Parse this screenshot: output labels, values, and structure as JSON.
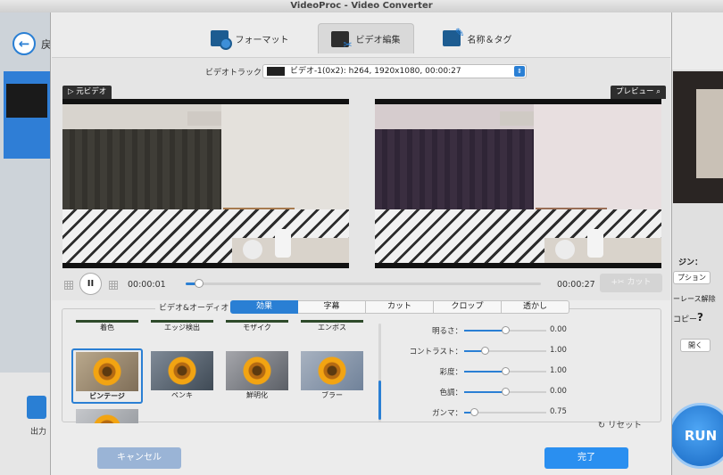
{
  "window": {
    "title": "VideoProc - Video Converter"
  },
  "background_app": {
    "back_label": "戻",
    "output_label": "出力",
    "right_text_1": "ジン：",
    "right_text_2": "プション",
    "right_text_3": "ーレース解除",
    "right_text_4": "コピー",
    "right_help": "?",
    "right_open": "開く",
    "run_label": "RUN"
  },
  "tabs": [
    {
      "label": "フォーマット",
      "icon": "format-icon"
    },
    {
      "label": "ビデオ編集",
      "icon": "video-edit-icon",
      "active": true
    },
    {
      "label": "名称＆タグ",
      "icon": "tag-icon"
    }
  ],
  "video": {
    "track_label": "ビデオトラック：",
    "track_value": "ビデオ-1(0x2): h264, 1920x1080, 00:00:27",
    "source_label": "▷ 元ビデオ",
    "preview_label": "プレビュー",
    "current_time": "00:00:01",
    "total_time": "00:00:27",
    "progress": 0.037,
    "cut_label": "カット"
  },
  "effects_panel": {
    "title": "ビデオ&オーディオ",
    "tabs": [
      "効果",
      "字幕",
      "カット",
      "クロップ",
      "透かし"
    ],
    "active_tab": "効果",
    "top_row_labels": [
      "着色",
      "エッジ検出",
      "モザイク",
      "エンボス"
    ],
    "effects": [
      {
        "label": "ビンテージ",
        "selected": true
      },
      {
        "label": "ペンキ"
      },
      {
        "label": "鮮明化"
      },
      {
        "label": "ブラー"
      }
    ],
    "adjustments": [
      {
        "label": "明るさ：",
        "value": "0.00",
        "level": 0.5
      },
      {
        "label": "コントラスト：",
        "value": "1.00",
        "level": 0.25
      },
      {
        "label": "彩度：",
        "value": "1.00",
        "level": 0.5
      },
      {
        "label": "色調：",
        "value": "0.00",
        "level": 0.5
      },
      {
        "label": "ガンマ：",
        "value": "0.75",
        "level": 0.12
      }
    ],
    "reset_label": "リセット"
  },
  "buttons": {
    "cancel": "キャンセル",
    "done": "完了"
  },
  "colors": {
    "accent": "#2a7fd4",
    "done": "#2a8ff0",
    "cancel_disabled": "#9ab4d6"
  }
}
